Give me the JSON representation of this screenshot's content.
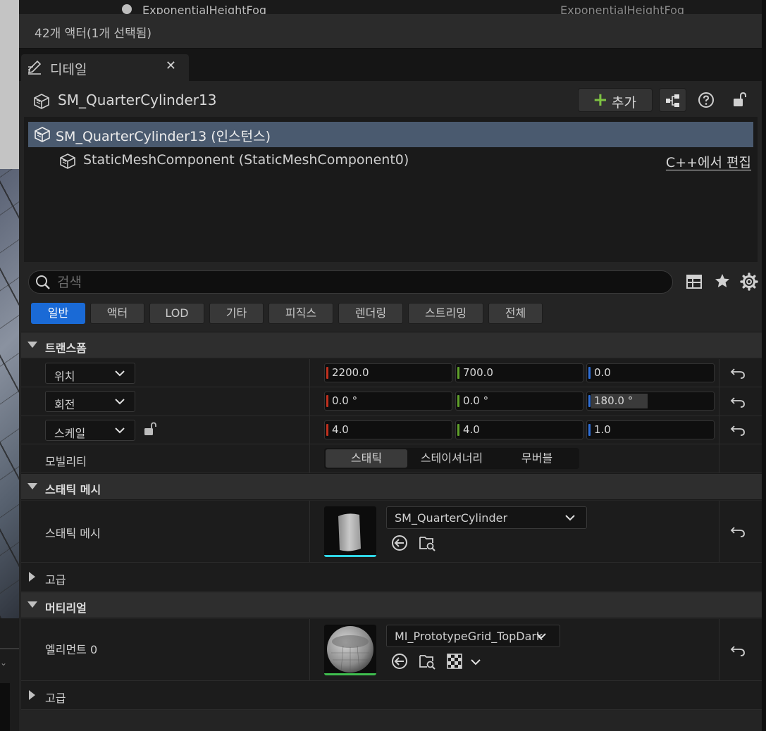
{
  "outliner": {
    "clipped_row_label": "ExponentialHeightFog",
    "clipped_row_type": "ExponentialHeightFog"
  },
  "status": {
    "actor_count": "42개 액터(1개 선택됨)"
  },
  "tab": {
    "label": "디테일"
  },
  "header": {
    "title": "SM_QuarterCylinder13",
    "add_label": "추가"
  },
  "tree": {
    "selected": "SM_QuarterCylinder13 (인스턴스)",
    "child": "StaticMeshComponent (StaticMeshComponent0)",
    "edit_cpp": "C++에서 편집"
  },
  "search": {
    "placeholder": "검색"
  },
  "filters": [
    "일반",
    "액터",
    "LOD",
    "기타",
    "피직스",
    "렌더링",
    "스트리밍",
    "전체"
  ],
  "transform": {
    "section": "트랜스폼",
    "location": {
      "label": "위치",
      "x": "2200.0",
      "y": "700.0",
      "z": "0.0"
    },
    "rotation": {
      "label": "회전",
      "x": "0.0 °",
      "y": "0.0 °",
      "z": "180.0 °"
    },
    "scale": {
      "label": "스케일",
      "x": "4.0",
      "y": "4.0",
      "z": "1.0"
    },
    "mobility": {
      "label": "모빌리티",
      "options": [
        "스태틱",
        "스테이셔너리",
        "무버블"
      ],
      "selected": "스태틱"
    }
  },
  "static_mesh": {
    "section": "스태틱 메시",
    "label": "스태틱 메시",
    "asset": "SM_QuarterCylinder",
    "advanced": "고급",
    "thumb_accent": "#2fd6e6"
  },
  "materials": {
    "section": "머티리얼",
    "label": "엘리먼트 0",
    "asset": "MI_PrototypeGrid_TopDark",
    "advanced": "고급",
    "thumb_accent": "#3fbf4f"
  },
  "colors": {
    "x_axis": "#c0301e",
    "y_axis": "#5fa02a",
    "z_axis": "#2e6fd8",
    "accent": "#1a6ad6",
    "selection": "#4a5a6f"
  },
  "icons": [
    "pencil-icon",
    "close-icon",
    "cube-icon",
    "plus-icon",
    "blueprint-icon",
    "help-icon",
    "lock-icon",
    "search-icon",
    "table-icon",
    "star-icon",
    "gear-icon",
    "chevron-down-icon",
    "reset-icon",
    "browse-back-icon",
    "find-in-browser-icon",
    "checker-icon"
  ]
}
